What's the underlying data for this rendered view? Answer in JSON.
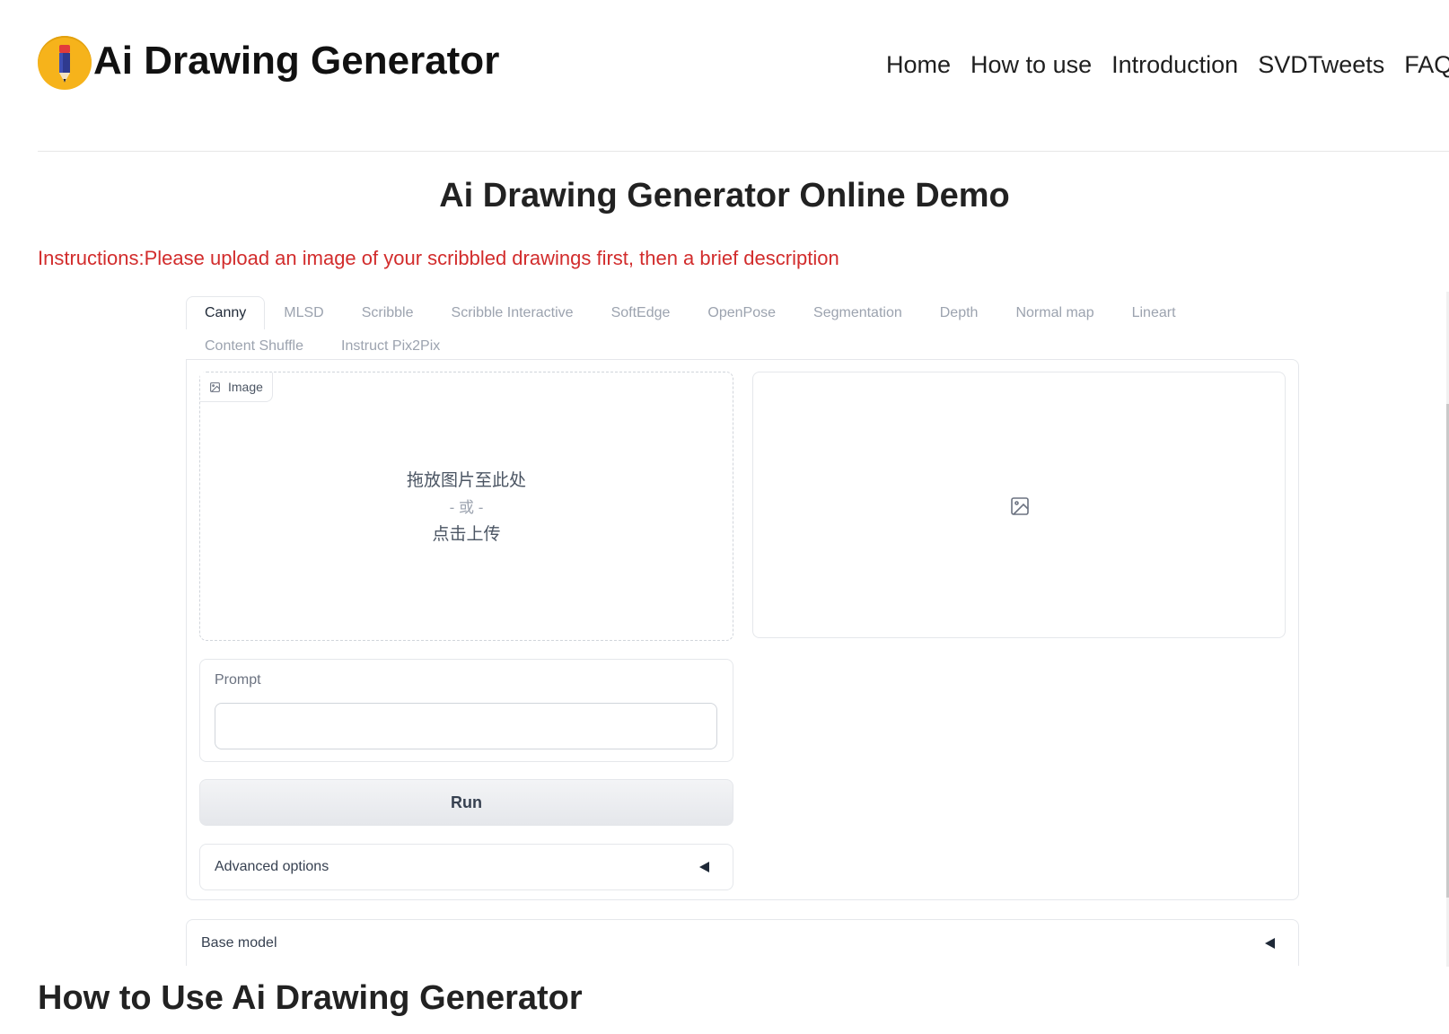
{
  "header": {
    "title": "Ai Drawing Generator",
    "logo_icon": "pencil-icon",
    "nav": [
      "Home",
      "How to use",
      "Introduction",
      "SVDTweets",
      "FAQ"
    ]
  },
  "main": {
    "title": "Ai Drawing Generator Online Demo",
    "instructions": "Instructions:Please upload an image of your scribbled drawings first, then a brief description"
  },
  "tabs": {
    "row1": [
      "Canny",
      "MLSD",
      "Scribble",
      "Scribble Interactive",
      "SoftEdge",
      "OpenPose",
      "Segmentation",
      "Depth",
      "Normal map",
      "Lineart"
    ],
    "row2": [
      "Content Shuffle",
      "Instruct Pix2Pix"
    ],
    "active": "Canny"
  },
  "upload": {
    "label": "Image",
    "line1": "拖放图片至此处",
    "line2": "- 或 -",
    "line3": "点击上传"
  },
  "prompt": {
    "label": "Prompt",
    "value": "",
    "placeholder": ""
  },
  "run": {
    "label": "Run"
  },
  "advanced": {
    "label": "Advanced options"
  },
  "base_model": {
    "label": "Base model"
  },
  "section": {
    "how_to_use_title": "How to Use Ai Drawing Generator"
  },
  "colors": {
    "logo_badge": "#f6b31b",
    "instructions": "#d22c2c"
  }
}
